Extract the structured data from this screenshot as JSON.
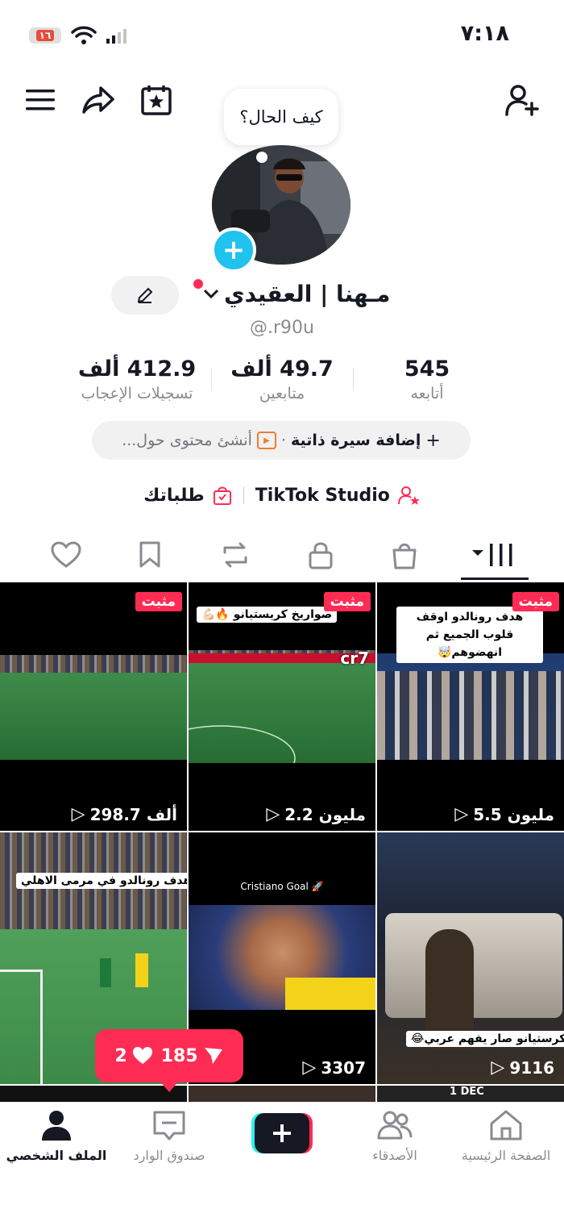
{
  "status_bar": {
    "time": "٧:١٨",
    "battery": "١٦"
  },
  "profile": {
    "speech_bubble": "كيف الحال؟",
    "name": "مـهنا | العقيدي",
    "handle": "@.r90u"
  },
  "stats": [
    {
      "value": "545",
      "label": "أتابعه"
    },
    {
      "value": "49.7 ألف",
      "label": "متابعين"
    },
    {
      "value": "412.9 ألف",
      "label": "تسجيلات الإعجاب"
    }
  ],
  "bio": {
    "add_bio": "إضافة سيرة ذاتية",
    "create_prompt": "أنشئ محتوى حول..."
  },
  "links": {
    "studio": "TikTok Studio",
    "orders": "طلباتك"
  },
  "videos": [
    {
      "views": "5.5 مليون",
      "pinned": "مثبت",
      "caption": "هدف رونالدو اوقف قلوب الجميع ثم انهضوهم🤯"
    },
    {
      "views": "2.2 مليون",
      "pinned": "مثبت",
      "caption": "صواريخ كريستيانو 🔥💪🏻",
      "tag": "cr7"
    },
    {
      "views": "298.7 ألف",
      "pinned": "مثبت"
    },
    {
      "views": "9116",
      "caption": "ولد كرستيانو صار يفهم عربي😂"
    },
    {
      "views": "3307",
      "caption": "Cristiano Goal 🚀"
    },
    {
      "views": "",
      "caption": "شاهد: هدف رونالدو في مرمى الاهلي"
    }
  ],
  "notification": {
    "shares": "185",
    "likes": "2"
  },
  "bottom_nav": {
    "home": "الصفحة الرئيسية",
    "friends": "الأصدقاء",
    "inbox": "صندوق الوارد",
    "profile": "الملف الشخصي"
  },
  "overlay": {
    "date": "1 DEC"
  },
  "colors": {
    "accent": "#fe2c55",
    "cyan": "#20c2ee"
  }
}
